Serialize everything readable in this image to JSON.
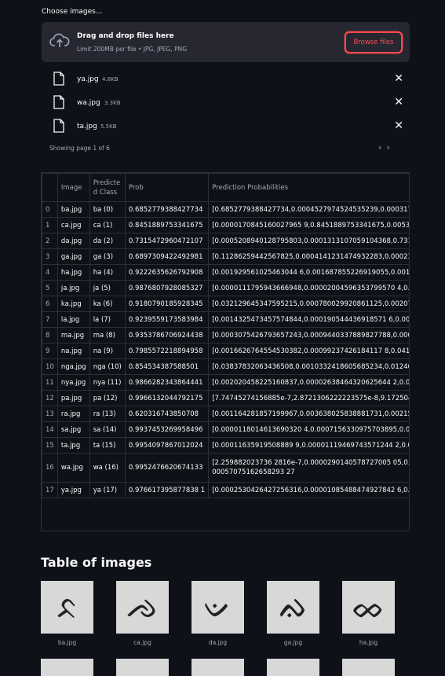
{
  "uploader": {
    "label": "Choose images...",
    "drop_title": "Drag and drop files here",
    "drop_sub": "Limit 200MB per file • JPG, JPEG, PNG",
    "browse_label": "Browse files"
  },
  "files": [
    {
      "name": "ya.jpg",
      "size": "4.8KB"
    },
    {
      "name": "wa.jpg",
      "size": "3.3KB"
    },
    {
      "name": "ta.jpg",
      "size": "5.5KB"
    }
  ],
  "pagination": {
    "text": "Showing page 1 of 6",
    "prev": "‹",
    "next": "›"
  },
  "table": {
    "headers": [
      "",
      "Image",
      "Predicted Class",
      "Prob",
      "Prediction Probabilities"
    ],
    "rows": [
      {
        "i": "0",
        "img": "ba.jpg",
        "cls": "ba (0)",
        "prob": "0.6852779388427734",
        "pp": "[0.6852779388427734,0.0004527974524535239,0.000317"
      },
      {
        "i": "1",
        "img": "ca.jpg",
        "cls": "ca (1)",
        "prob": "0.8451889753341675",
        "pp": "[0.0000170845160027965 9,0.8451889753341675,0.00534"
      },
      {
        "i": "2",
        "img": "da.jpg",
        "cls": "da (2)",
        "prob": "0.7315472960472107",
        "pp": "[0.0005208940128795803,0.0001313107059104368,0.731"
      },
      {
        "i": "3",
        "img": "ga.jpg",
        "cls": "ga (3)",
        "prob": "0.6897309422492981",
        "pp": "[0.11286259442567825,0.0004141231474932283,0.00023"
      },
      {
        "i": "4",
        "img": "ha.jpg",
        "cls": "ha (4)",
        "prob": "0.9222635626792908",
        "pp": "[0.001929561025463044 6,0.001687855226919055,0.0018"
      },
      {
        "i": "5",
        "img": "ja.jpg",
        "cls": "ja (5)",
        "prob": "0.9876807928085327",
        "pp": "[0.0000111795943666948,0.00002004596353799570 4,0.0"
      },
      {
        "i": "6",
        "img": "ka.jpg",
        "cls": "ka (6)",
        "prob": "0.9180790185928345",
        "pp": "[0.032129645347595215,0.000780029920861125,0.00207"
      },
      {
        "i": "7",
        "img": "la.jpg",
        "cls": "la (7)",
        "prob": "0.9239559173583984",
        "pp": "[0.0014325473457574844,0.000190544436918571 6,0.000"
      },
      {
        "i": "8",
        "img": "ma.jpg",
        "cls": "ma (8)",
        "prob": "0.9353786706924438",
        "pp": "[0.0003075426793657243,0.0009440337889827788,0.000"
      },
      {
        "i": "9",
        "img": "na.jpg",
        "cls": "na (9)",
        "prob": "0.7985572218894958",
        "pp": "[0.0016626764554530382,0.00099237426184117 8,0.0416"
      },
      {
        "i": "10",
        "img": "nga.jpg",
        "cls": "nga (10)",
        "prob": "0.854534387588501",
        "pp": "[0.03837832063436508,0.0010332418605685234,0.01246"
      },
      {
        "i": "11",
        "img": "nya.jpg",
        "cls": "nya (11)",
        "prob": "0.9866282343864441",
        "pp": "[0.002020458225160837,0.00002638464320625644 2,0.00"
      },
      {
        "i": "12",
        "img": "pa.jpg",
        "cls": "pa (12)",
        "prob": "0.9966132044792175",
        "pp": "[7.74745274156885e-7,2.8721306222223575e-8,9.172504"
      },
      {
        "i": "13",
        "img": "ra.jpg",
        "cls": "ra (13)",
        "prob": "0.620316743850708",
        "pp": "[0.001164281857199967,0.003638025838881731,0.00215"
      },
      {
        "i": "14",
        "img": "sa.jpg",
        "cls": "sa (14)",
        "prob": "0.9937453269958496",
        "pp": "[0.0000118014613690320 4,0.0007156330975703895,0.000"
      },
      {
        "i": "15",
        "img": "ta.jpg",
        "cls": "ta (15)",
        "prob": "0.9954097867012024",
        "pp": "[0.00011635919508889 9,0.00001119469743571244 2,0.000"
      },
      {
        "i": "16",
        "img": "wa.jpg",
        "cls": "wa (16)",
        "prob": "0.9952476620674133",
        "pp": "[2.259882023736 2816e-7,0.0000290140578727005 05,0.0000057075162658293 27"
      },
      {
        "i": "17",
        "img": "ya.jpg",
        "cls": "ya (17)",
        "prob": "0.976617395877838 1",
        "pp": "[0.0002530426427256316,0.00001085488474927842 6,0.00"
      }
    ]
  },
  "gallery": {
    "title": "Table of images",
    "captions": [
      "ba.jpg",
      "ca.jpg",
      "da.jpg",
      "ga.jpg",
      "ha.jpg"
    ],
    "glyphs": [
      "ᨅ",
      "ᨌ",
      "ᨉ",
      "ᨁ",
      "ᨖ"
    ]
  },
  "colors": {
    "accent": "#ff4b4b",
    "bg": "#0e1117",
    "panel": "#262730",
    "muted": "#a3a8b8"
  }
}
